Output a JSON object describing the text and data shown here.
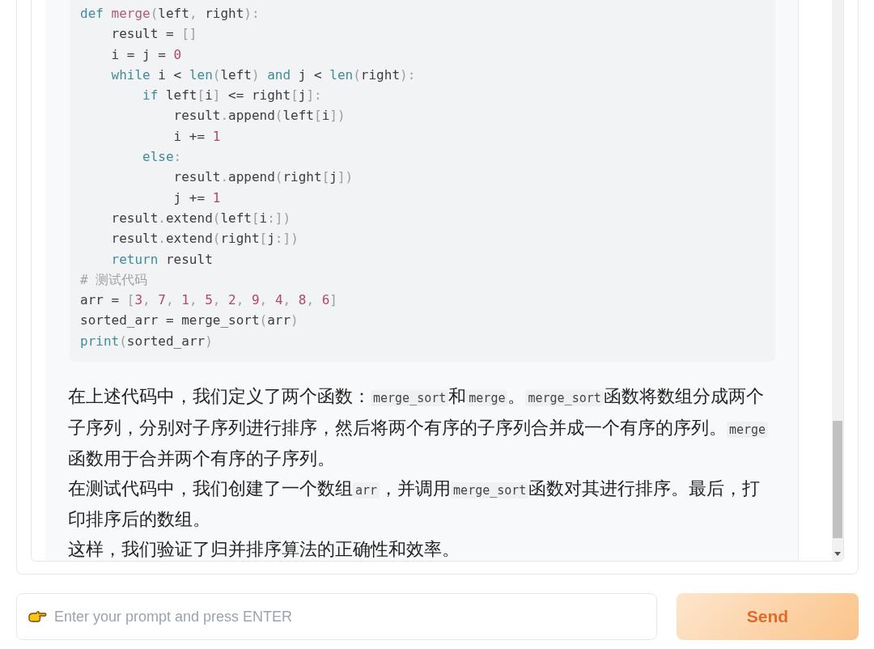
{
  "code_lines": [
    [
      {
        "kind": "kw",
        "text": "def"
      },
      {
        "kind": "fn",
        "text": " merge"
      },
      {
        "kind": "punc",
        "text": "("
      },
      {
        "kind": "plain",
        "text": "left"
      },
      {
        "kind": "punc",
        "text": ","
      },
      {
        "kind": "plain",
        "text": " right"
      },
      {
        "kind": "punc",
        "text": "):"
      }
    ],
    [
      {
        "kind": "plain",
        "text": "    result = "
      },
      {
        "kind": "punc",
        "text": "[]"
      }
    ],
    [
      {
        "kind": "plain",
        "text": "    i = j = "
      },
      {
        "kind": "num",
        "text": "0"
      }
    ],
    [
      {
        "kind": "kw",
        "text": "    while"
      },
      {
        "kind": "plain",
        "text": " i < "
      },
      {
        "kind": "kw",
        "text": "len"
      },
      {
        "kind": "punc",
        "text": "("
      },
      {
        "kind": "plain",
        "text": "left"
      },
      {
        "kind": "punc",
        "text": ")"
      },
      {
        "kind": "kw",
        "text": " and"
      },
      {
        "kind": "plain",
        "text": " j < "
      },
      {
        "kind": "kw",
        "text": "len"
      },
      {
        "kind": "punc",
        "text": "("
      },
      {
        "kind": "plain",
        "text": "right"
      },
      {
        "kind": "punc",
        "text": "):"
      }
    ],
    [
      {
        "kind": "kw",
        "text": "        if"
      },
      {
        "kind": "plain",
        "text": " left"
      },
      {
        "kind": "punc",
        "text": "["
      },
      {
        "kind": "plain",
        "text": "i"
      },
      {
        "kind": "punc",
        "text": "]"
      },
      {
        "kind": "plain",
        "text": " <= right"
      },
      {
        "kind": "punc",
        "text": "["
      },
      {
        "kind": "plain",
        "text": "j"
      },
      {
        "kind": "punc",
        "text": "]:"
      }
    ],
    [
      {
        "kind": "plain",
        "text": "            result"
      },
      {
        "kind": "punc",
        "text": "."
      },
      {
        "kind": "plain",
        "text": "append"
      },
      {
        "kind": "punc",
        "text": "("
      },
      {
        "kind": "plain",
        "text": "left"
      },
      {
        "kind": "punc",
        "text": "["
      },
      {
        "kind": "plain",
        "text": "i"
      },
      {
        "kind": "punc",
        "text": "])"
      }
    ],
    [
      {
        "kind": "plain",
        "text": "            i += "
      },
      {
        "kind": "num",
        "text": "1"
      }
    ],
    [
      {
        "kind": "kw",
        "text": "        else"
      },
      {
        "kind": "punc",
        "text": ":"
      }
    ],
    [
      {
        "kind": "plain",
        "text": "            result"
      },
      {
        "kind": "punc",
        "text": "."
      },
      {
        "kind": "plain",
        "text": "append"
      },
      {
        "kind": "punc",
        "text": "("
      },
      {
        "kind": "plain",
        "text": "right"
      },
      {
        "kind": "punc",
        "text": "["
      },
      {
        "kind": "plain",
        "text": "j"
      },
      {
        "kind": "punc",
        "text": "])"
      }
    ],
    [
      {
        "kind": "plain",
        "text": "            j += "
      },
      {
        "kind": "num",
        "text": "1"
      }
    ],
    [
      {
        "kind": "plain",
        "text": "    result"
      },
      {
        "kind": "punc",
        "text": "."
      },
      {
        "kind": "plain",
        "text": "extend"
      },
      {
        "kind": "punc",
        "text": "("
      },
      {
        "kind": "plain",
        "text": "left"
      },
      {
        "kind": "punc",
        "text": "["
      },
      {
        "kind": "plain",
        "text": "i"
      },
      {
        "kind": "punc",
        "text": ":])"
      }
    ],
    [
      {
        "kind": "plain",
        "text": "    result"
      },
      {
        "kind": "punc",
        "text": "."
      },
      {
        "kind": "plain",
        "text": "extend"
      },
      {
        "kind": "punc",
        "text": "("
      },
      {
        "kind": "plain",
        "text": "right"
      },
      {
        "kind": "punc",
        "text": "["
      },
      {
        "kind": "plain",
        "text": "j"
      },
      {
        "kind": "punc",
        "text": ":])"
      }
    ],
    [
      {
        "kind": "kw",
        "text": "    return"
      },
      {
        "kind": "plain",
        "text": " result"
      }
    ],
    [
      {
        "kind": "comment",
        "text": "# 测试代码"
      }
    ],
    [
      {
        "kind": "plain",
        "text": "arr = "
      },
      {
        "kind": "punc",
        "text": "["
      },
      {
        "kind": "num",
        "text": "3"
      },
      {
        "kind": "punc",
        "text": ", "
      },
      {
        "kind": "num",
        "text": "7"
      },
      {
        "kind": "punc",
        "text": ", "
      },
      {
        "kind": "num",
        "text": "1"
      },
      {
        "kind": "punc",
        "text": ", "
      },
      {
        "kind": "num",
        "text": "5"
      },
      {
        "kind": "punc",
        "text": ", "
      },
      {
        "kind": "num",
        "text": "2"
      },
      {
        "kind": "punc",
        "text": ", "
      },
      {
        "kind": "num",
        "text": "9"
      },
      {
        "kind": "punc",
        "text": ", "
      },
      {
        "kind": "num",
        "text": "4"
      },
      {
        "kind": "punc",
        "text": ", "
      },
      {
        "kind": "num",
        "text": "8"
      },
      {
        "kind": "punc",
        "text": ", "
      },
      {
        "kind": "num",
        "text": "6"
      },
      {
        "kind": "punc",
        "text": "]"
      }
    ],
    [
      {
        "kind": "plain",
        "text": "sorted_arr = merge_sort"
      },
      {
        "kind": "punc",
        "text": "("
      },
      {
        "kind": "plain",
        "text": "arr"
      },
      {
        "kind": "punc",
        "text": ")"
      }
    ],
    [
      {
        "kind": "kw",
        "text": "print"
      },
      {
        "kind": "punc",
        "text": "("
      },
      {
        "kind": "plain",
        "text": "sorted_arr"
      },
      {
        "kind": "punc",
        "text": ")"
      }
    ]
  ],
  "paragraphs": [
    [
      {
        "kind": "text",
        "text": "在上述代码中，我们定义了两个函数："
      },
      {
        "kind": "code",
        "text": "merge_sort"
      },
      {
        "kind": "text",
        "text": "和"
      },
      {
        "kind": "code",
        "text": "merge"
      },
      {
        "kind": "text",
        "text": "。"
      },
      {
        "kind": "code",
        "text": "merge_sort"
      },
      {
        "kind": "text",
        "text": "函数将数组分成两个子序列，分别对子序列进行排序，然后将两个有序的子序列合并成一个有序的序列。"
      },
      {
        "kind": "code",
        "text": "merge"
      },
      {
        "kind": "text",
        "text": "函数用于合并两个有序的子序列。"
      }
    ],
    [
      {
        "kind": "text",
        "text": "在测试代码中，我们创建了一个数组"
      },
      {
        "kind": "code",
        "text": "arr"
      },
      {
        "kind": "text",
        "text": "，并调用"
      },
      {
        "kind": "code",
        "text": "merge_sort"
      },
      {
        "kind": "text",
        "text": "函数对其进行排序。最后，打印排序后的数组。"
      }
    ],
    [
      {
        "kind": "text",
        "text": "这样，我们验证了归并排序算法的正确性和效率。"
      }
    ]
  ],
  "prompt": {
    "placeholder": "Enter your prompt and press ENTER"
  },
  "send_button": "Send"
}
